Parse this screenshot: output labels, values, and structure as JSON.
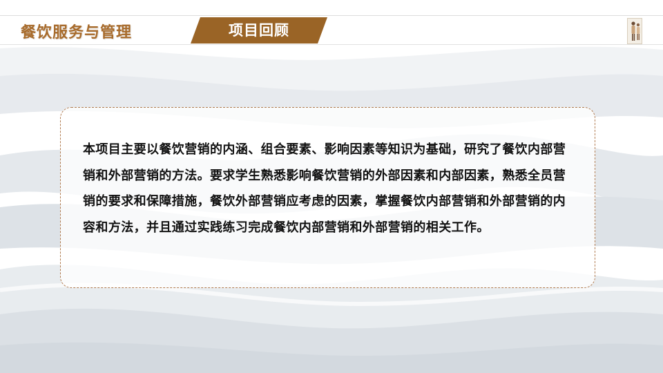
{
  "header": {
    "course_title": "餐饮服务与管理",
    "section_title": "项目回顾"
  },
  "content": {
    "paragraph": "本项目主要以餐饮营销的内涵、组合要素、影响因素等知识为基础，研究了餐饮内部营销和外部营销的方法。要求学生熟悉影响餐饮营销的外部因素和内部因素，熟悉全员营销的要求和保障措施，餐饮外部营销应考虑的因素，掌握餐饮内部营销和外部营销的内容和方法，并且通过实践练习完成餐饮内部营销和外部营销的相关工作。"
  },
  "colors": {
    "brand_brown": "#a86b2b",
    "tab_brown": "#9a6426",
    "box_border": "#b07a4e",
    "text": "#111111",
    "wave_light": "#eef0f2",
    "wave_mid": "#dde2e7"
  },
  "icons": {
    "header_figure": "figure-illustration-icon"
  }
}
